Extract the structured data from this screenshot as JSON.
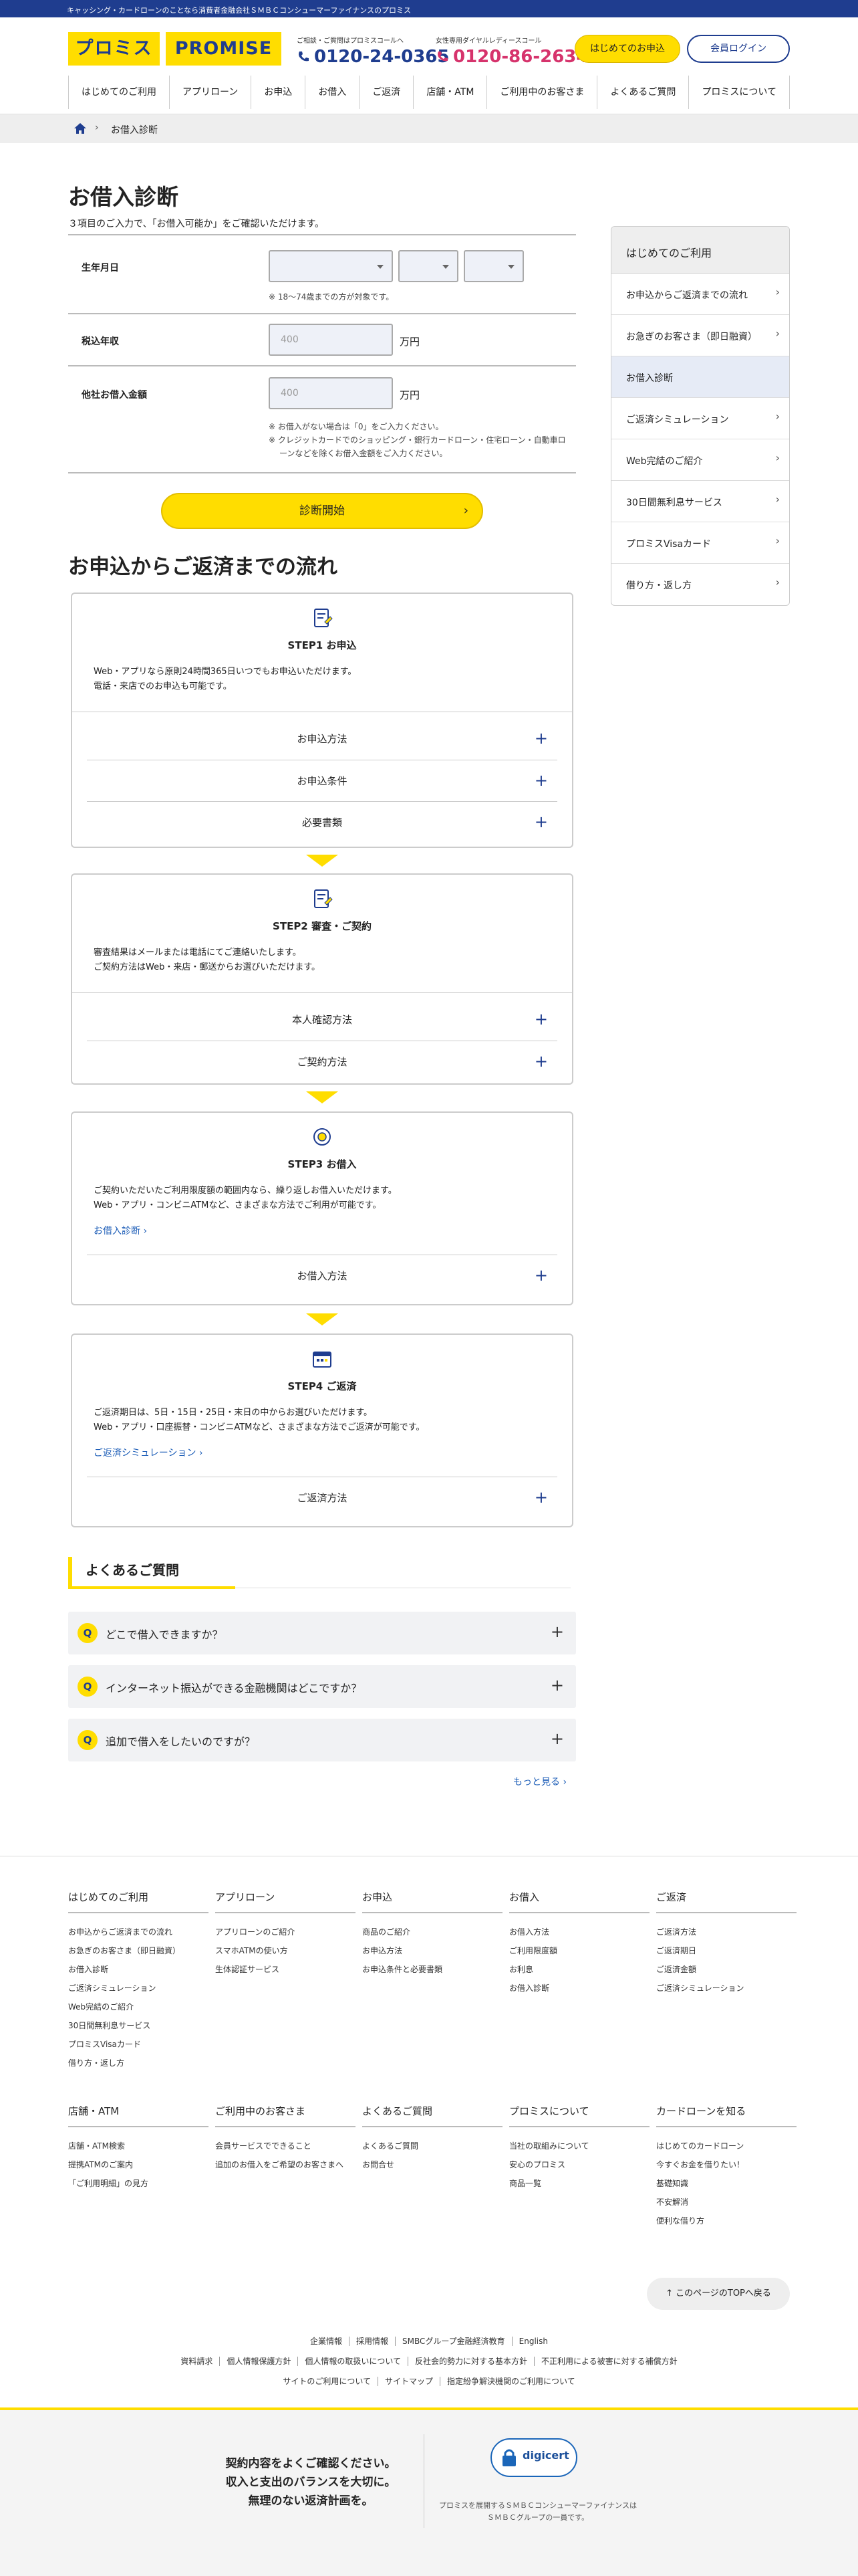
{
  "topbar": {
    "text": "キャッシング・カードローンのことなら消費者金融会社ＳＭＢＣコンシューマーファイナンスのプロミス"
  },
  "header": {
    "logo_left": "プロミス",
    "logo_right": "PROMISE",
    "tel1_caption": "ご相談・ご質問はプロミスコールへ",
    "tel1_number": "0120-24-0365",
    "tel2_caption": "女性専用ダイヤルレディースコール",
    "tel2_number": "0120-86-2634",
    "first_button": "はじめてのお申込",
    "login_button": "会員ログイン",
    "colors": {
      "brand_yellow": "#ffdd00",
      "brand_navy": "#1f3d8f",
      "tel2": "#d6336c"
    }
  },
  "gnav": [
    "はじめてのご利用",
    "アプリローン",
    "お申込",
    "お借入",
    "ご返済",
    "店舗・ATM",
    "ご利用中のお客さま",
    "よくあるご質問",
    "プロミスについて"
  ],
  "breadcrumb": {
    "current": "お借入診断"
  },
  "page": {
    "title": "お借入診断",
    "lead": "３項目のご入力で、「お借入可能か」をご確認いただけます。"
  },
  "form": {
    "dob_label": "生年月日",
    "dob_note": "18〜74歳までの方が対象です。",
    "income_label": "税込年収",
    "income_placeholder": "400",
    "income_unit": "万円",
    "other_label": "他社お借入金額",
    "other_placeholder": "400",
    "other_unit": "万円",
    "other_note1": "お借入がない場合は「0」をご入力ください。",
    "other_note2a": "クレジットカードでのショッピング・銀行カードローン・住宅ローン・自動車ロ",
    "other_note2b": "ーンなどを除くお借入金額をご入力ください。",
    "submit": "診断開始"
  },
  "flow": {
    "title": "お申込からご返済までの流れ",
    "steps": [
      {
        "title": "STEP1 お申込",
        "desc1": "Web・アプリなら原則24時間365日いつでもお申込いただけます。",
        "desc2": "電話・来店でのお申込も可能です。",
        "acc": [
          "お申込方法",
          "お申込条件",
          "必要書類"
        ]
      },
      {
        "title": "STEP2 審査・ご契約",
        "desc1": "審査結果はメールまたは電話にてご連絡いたします。",
        "desc2": "ご契約方法はWeb・来店・郵送からお選びいただけます。",
        "acc": [
          "本人確認方法",
          "ご契約方法"
        ]
      },
      {
        "title": "STEP3 お借入",
        "desc1": "ご契約いただいたご利用限度額の範囲内なら、繰り返しお借入いただけます。",
        "desc2": "Web・アプリ・コンビニATMなど、さまざまな方法でご利用が可能です。",
        "link": "お借入診断",
        "acc": [
          "お借入方法"
        ]
      },
      {
        "title": "STEP4 ご返済",
        "desc1": "ご返済期日は、5日・15日・25日・末日の中からお選びいただけます。",
        "desc2": "Web・アプリ・口座振替・コンビニATMなど、さまざまな方法でご返済が可能です。",
        "link": "ご返済シミュレーション",
        "acc": [
          "ご返済方法"
        ]
      }
    ]
  },
  "faq": {
    "title": "よくあるご質問",
    "q_mark": "Q",
    "items": [
      "どこで借入できますか？",
      "インターネット振込ができる金融機関はどこですか？",
      "追加で借入をしたいのですが？"
    ],
    "more": "もっと見る"
  },
  "sidebar": {
    "heading": "はじめてのご利用",
    "items": [
      "お申込からご返済までの流れ",
      "お急ぎのお客さま（即日融資）",
      "お借入診断",
      "ご返済シミュレーション",
      "Web完結のご紹介",
      "30日間無利息サービス",
      "プロミスVisaカード",
      "借り方・返し方"
    ]
  },
  "footer": {
    "cols1": [
      {
        "title": "はじめてのご利用",
        "links": [
          "お申込からご返済までの流れ",
          "お急ぎのお客さま（即日融資）",
          "お借入診断",
          "ご返済シミュレーション",
          "Web完結のご紹介",
          "30日間無利息サービス",
          "プロミスVisaカード",
          "借り方・返し方"
        ]
      },
      {
        "title": "アプリローン",
        "links": [
          "アプリローンのご紹介",
          "スマホATMの使い方",
          "生体認証サービス"
        ]
      },
      {
        "title": "お申込",
        "links": [
          "商品のご紹介",
          "お申込方法",
          "お申込条件と必要書類"
        ]
      },
      {
        "title": "お借入",
        "links": [
          "お借入方法",
          "ご利用限度額",
          "お利息",
          "お借入診断"
        ]
      },
      {
        "title": "ご返済",
        "links": [
          "ご返済方法",
          "ご返済期日",
          "ご返済金額",
          "ご返済シミュレーション"
        ]
      }
    ],
    "cols2": [
      {
        "title": "店舗・ATM",
        "links": [
          "店舗・ATM検索",
          "提携ATMのご案内",
          "「ご利用明細」の見方"
        ]
      },
      {
        "title": "ご利用中のお客さま",
        "links": [
          "会員サービスでできること",
          "追加のお借入をご希望のお客さまへ"
        ]
      },
      {
        "title": "よくあるご質問",
        "links": [
          "よくあるご質問",
          "お問合せ"
        ]
      },
      {
        "title": "プロミスについて",
        "links": [
          "当社の取組みについて",
          "安心のプロミス",
          "商品一覧"
        ]
      },
      {
        "title": "カードローンを知る",
        "links": [
          "はじめてのカードローン",
          "今すぐお金を借りたい！",
          "基礎知識",
          "不安解消",
          "便利な借り方"
        ]
      }
    ],
    "to_top": "このページのTOPへ戻る",
    "links_row1": [
      "企業情報",
      "採用情報",
      "SMBCグループ金融経済教育",
      "English"
    ],
    "links_row2": [
      "資料請求",
      "個人情報保護方針",
      "個人情報の取扱いについて",
      "反社会的勢力に対する基本方針",
      "不正利用による被害に対する補償方針"
    ],
    "links_row3": [
      "サイトのご利用について",
      "サイトマップ",
      "指定紛争解決機関のご利用について"
    ],
    "message1": "契約内容をよくご確認ください。",
    "message2": "収入と支出のバランスを大切に。",
    "message3": "無理のない返済計画を。",
    "digicert": "digicert",
    "company1": "プロミスを展開するＳＭＢＣコンシューマーファイナンスは",
    "company2": "ＳＭＢＣグループの一員です。"
  }
}
